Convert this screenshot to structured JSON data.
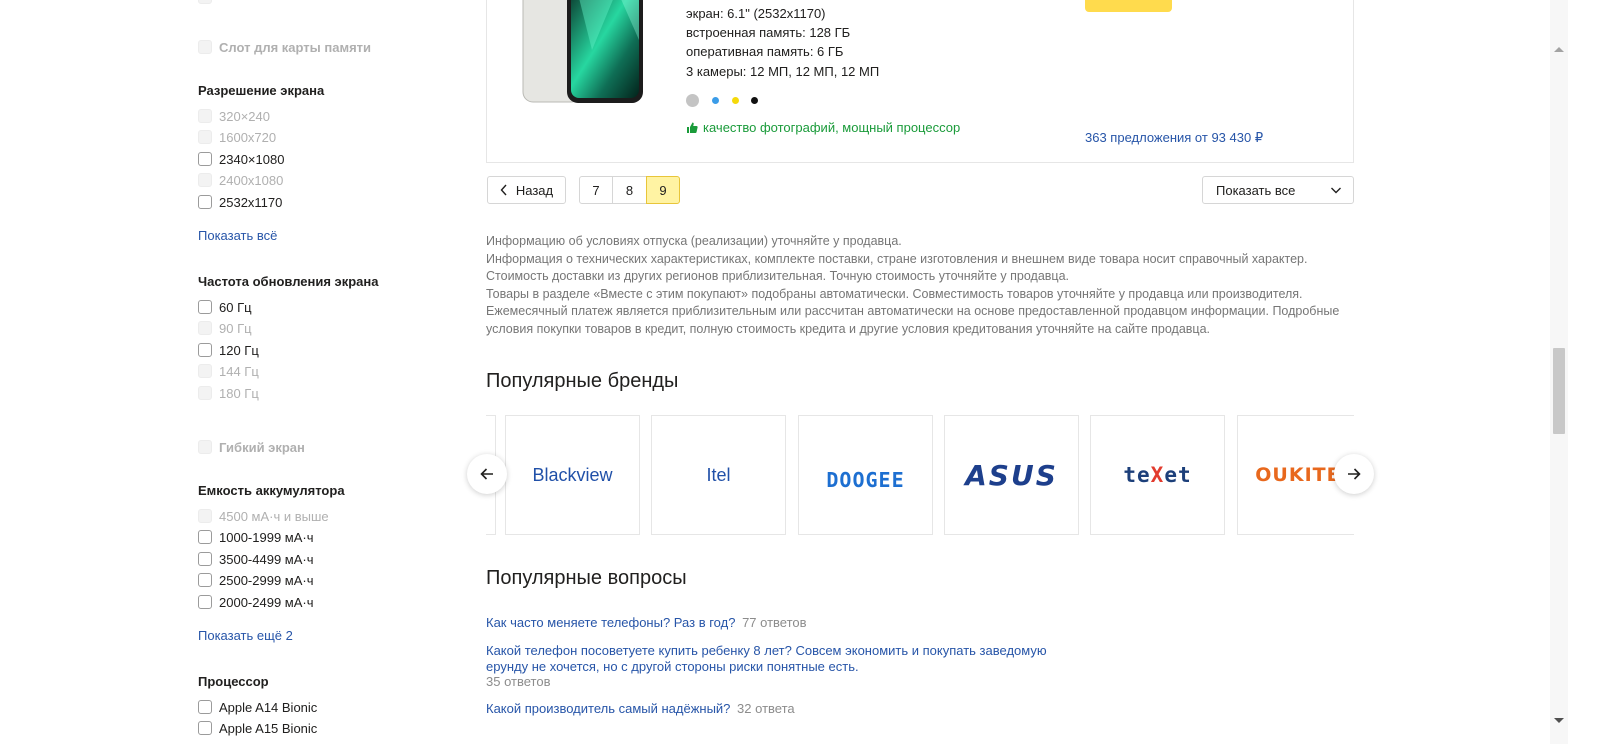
{
  "sidebar": {
    "memory_slot": "Слот для карты памяти",
    "resolution": {
      "title": "Разрешение экрана",
      "options": [
        "320×240",
        "1600x720",
        "2340×1080",
        "2400x1080",
        "2532x1170"
      ],
      "show_all": "Показать всё"
    },
    "refresh": {
      "title": "Частота обновления экрана",
      "options": [
        "60 Гц",
        "90 Гц",
        "120 Гц",
        "144 Гц",
        "180 Гц"
      ]
    },
    "flexible": "Гибкий экран",
    "battery": {
      "title": "Емкость аккумулятора",
      "options": [
        "4500 мА·ч и выше",
        "1000-1999 мА·ч",
        "3500-4499 мА·ч",
        "2500-2999 мА·ч",
        "2000-2499 мА·ч"
      ],
      "show_more": "Показать ещё 2"
    },
    "processor": {
      "title": "Процессор",
      "options": [
        "Apple A14 Bionic",
        "Apple A15 Bionic"
      ]
    }
  },
  "product": {
    "specs": [
      "экран: 6.1\" (2532x1170)",
      "встроенная память: 128 ГБ",
      "оперативная память: 6 ГБ",
      "3 камеры: 12 МП, 12 МП, 12 МП"
    ],
    "colors": [
      "#c4c4c4",
      "#3b9ce8",
      "#f5d90a",
      "#111111"
    ],
    "pros": "качество фотографий, мощный процессор",
    "offers": "363 предложения от 93 430 ₽"
  },
  "pagination": {
    "back": "Назад",
    "pages": [
      "7",
      "8",
      "9"
    ],
    "active_page": "9",
    "show_all": "Показать все"
  },
  "disclaimer": [
    "Информацию об условиях отпуска (реализации) уточняйте у продавца.",
    "Информация о технических характеристиках, комплекте поставки, стране изготовления и внешнем виде товара носит справочный характер.",
    "Стоимость доставки из других регионов приблизительная. Точную стоимость уточняйте у продавца.",
    "Товары в разделе «Вместе с этим покупают» подобраны автоматически. Совместимость товаров уточняйте у продавца или производителя.",
    "Ежемесячный платеж является приблизительным или рассчитан автоматически на основе предоставленной продавцом информации. Подробные условия покупки товаров в кредит, полную стоимость кредита и другие условия кредитования уточняйте на сайте продавца."
  ],
  "brands": {
    "title": "Популярные бренды",
    "items": [
      "Blackview",
      "Itel",
      "DOOGEE",
      "ASUS",
      "teXet",
      "OUKITEL"
    ]
  },
  "questions": {
    "title": "Популярные вопросы",
    "items": [
      {
        "q": "Как часто меняете телефоны? Раз в год?",
        "count": "77 ответов"
      },
      {
        "q": "Какой телефон посоветуете купить ребенку 8 лет? Совсем экономить и покупать заведомую ерунду не хочется, но с другой стороны риски понятные есть.",
        "count": "35 ответов"
      },
      {
        "q": "Какой производитель самый надёжный?",
        "count": "32 ответа"
      }
    ]
  },
  "colors": {
    "link": "#2755a8",
    "pros_green": "#1a9b3a",
    "active_page": "#fff3a3",
    "buy_button": "#ffdb4d"
  }
}
